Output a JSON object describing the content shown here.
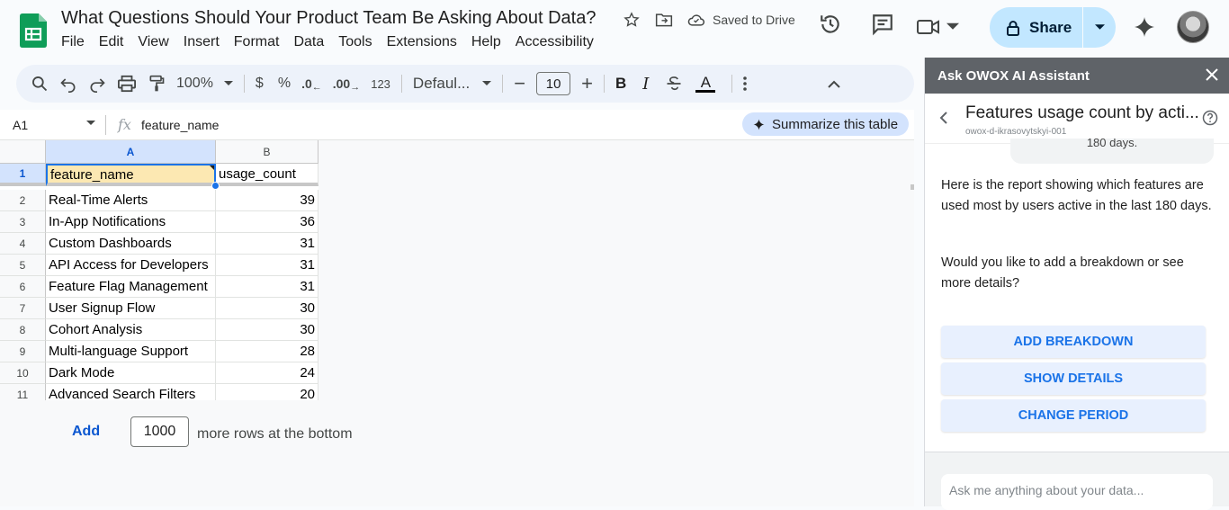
{
  "app": {
    "title": "What Questions Should Your Product Team Be Asking About Data?",
    "saved_status": "Saved to Drive",
    "share_label": "Share",
    "menus": [
      "File",
      "Edit",
      "View",
      "Insert",
      "Format",
      "Data",
      "Tools",
      "Extensions",
      "Help",
      "Accessibility"
    ]
  },
  "toolbar": {
    "zoom": "100%",
    "currency": "$",
    "percent": "%",
    "dec_decrease": ".0",
    "dec_increase": ".00",
    "format_num": "123",
    "font": "Defaul...",
    "font_size": "10",
    "bold": "B",
    "italic": "I",
    "text_color": "A"
  },
  "formula_bar": {
    "name_box": "A1",
    "fx": "fx",
    "value": "feature_name",
    "summarize_label": "Summarize this table"
  },
  "sheet": {
    "columns": [
      "A",
      "B"
    ],
    "header": [
      "feature_name",
      "usage_count"
    ],
    "rows": [
      {
        "n": "2",
        "feature": "Real-Time Alerts",
        "count": "39"
      },
      {
        "n": "3",
        "feature": "In-App Notifications",
        "count": "36"
      },
      {
        "n": "4",
        "feature": "Custom Dashboards",
        "count": "31"
      },
      {
        "n": "5",
        "feature": "API Access for Developers",
        "count": "31"
      },
      {
        "n": "6",
        "feature": "Feature Flag Management",
        "count": "31"
      },
      {
        "n": "7",
        "feature": "User Signup Flow",
        "count": "30"
      },
      {
        "n": "8",
        "feature": "Cohort Analysis",
        "count": "30"
      },
      {
        "n": "9",
        "feature": "Multi-language Support",
        "count": "28"
      },
      {
        "n": "10",
        "feature": "Dark Mode",
        "count": "24"
      },
      {
        "n": "11",
        "feature": "Advanced Search Filters",
        "count": "20"
      }
    ],
    "add_label": "Add",
    "add_rows_value": "1000",
    "add_rows_suffix": "more rows at the bottom"
  },
  "panel": {
    "header": "Ask OWOX AI Assistant",
    "title": "Features usage count by acti...",
    "subtitle": "owox-d-ikrasovytskyi-001",
    "bubble_fragment": "180 days.",
    "message_1": "Here is the report showing which features are used most by users active in the last 180 days.",
    "message_2": "Would you like to add a breakdown or see more details?",
    "buttons": [
      "ADD BREAKDOWN",
      "SHOW DETAILS",
      "CHANGE PERIOD"
    ],
    "input_placeholder": "Ask me anything about your data..."
  },
  "colors": {
    "accent": "#1a73e8",
    "share_bg": "#c2e7ff",
    "sheets_green": "#0f9d58",
    "selection_fill": "#fce8b2"
  }
}
